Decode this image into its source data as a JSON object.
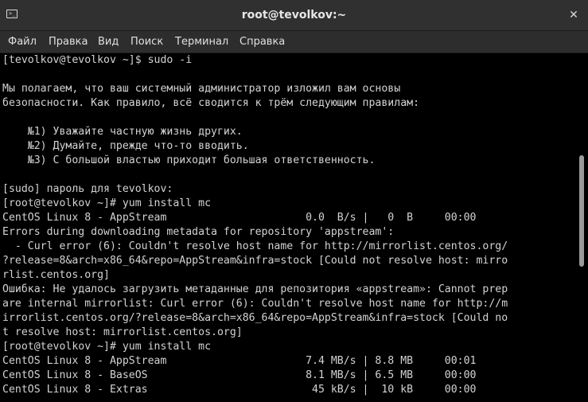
{
  "window": {
    "title": "root@tevolkov:~",
    "app_icon": "terminal-icon",
    "close_icon": "close-icon"
  },
  "menu": {
    "items": [
      "Файл",
      "Правка",
      "Вид",
      "Поиск",
      "Терминал",
      "Справка"
    ]
  },
  "terminal": {
    "lines": [
      "[tevolkov@tevolkov ~]$ sudo -i",
      "",
      "Мы полагаем, что ваш системный администратор изложил вам основы",
      "безопасности. Как правило, всё сводится к трём следующим правилам:",
      "",
      "    №1) Уважайте частную жизнь других.",
      "    №2) Думайте, прежде что-то вводить.",
      "    №3) С большой властью приходит большая ответственность.",
      "",
      "[sudo] пароль для tevolkov:",
      "[root@tevolkov ~]# yum install mc",
      "CentOS Linux 8 - AppStream                      0.0  B/s |   0  B     00:00",
      "Errors during downloading metadata for repository 'appstream':",
      "  - Curl error (6): Couldn't resolve host name for http://mirrorlist.centos.org/",
      "?release=8&arch=x86_64&repo=AppStream&infra=stock [Could not resolve host: mirro",
      "rlist.centos.org]",
      "Ошибка: Не удалось загрузить метаданные для репозитория «appstream»: Cannot prep",
      "are internal mirrorlist: Curl error (6): Couldn't resolve host name for http://m",
      "irrorlist.centos.org/?release=8&arch=x86_64&repo=AppStream&infra=stock [Could no",
      "t resolve host: mirrorlist.centos.org]",
      "[root@tevolkov ~]# yum install mc",
      "CentOS Linux 8 - AppStream                      7.4 MB/s | 8.8 MB     00:01",
      "CentOS Linux 8 - BaseOS                         8.1 MB/s | 6.5 MB     00:00",
      "CentOS Linux 8 - Extras                          45 kB/s |  10 kB     00:00"
    ]
  },
  "colors": {
    "terminal_bg": "#000000",
    "terminal_fg": "#d3d3d3",
    "titlebar_bg": "#303030",
    "menubar_bg": "#2d2d2d"
  }
}
